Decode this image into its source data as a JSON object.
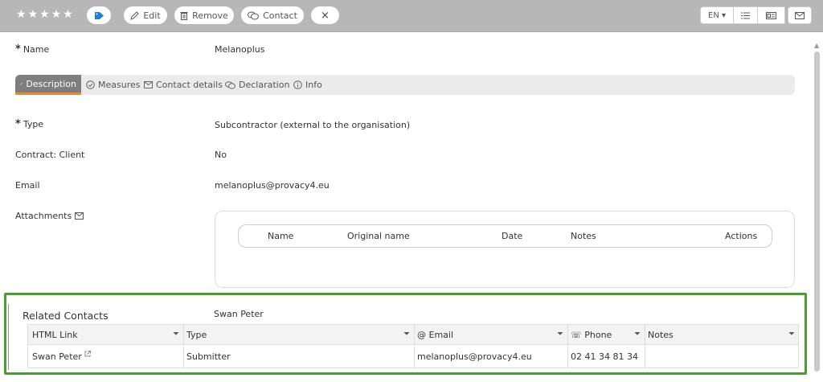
{
  "toolbar": {
    "rating": 5,
    "edit_label": "Edit",
    "remove_label": "Remove",
    "contact_label": "Contact",
    "close_label": "×",
    "language_label": "EN ▾"
  },
  "fields": {
    "name_label": "Name",
    "name_value": "Melanoplus",
    "type_label": "Type",
    "type_value": "Subcontractor (external to the organisation)",
    "contract_label": "Contract: Client",
    "contract_value": "No",
    "email_label": "Email",
    "email_value": "melanoplus@provacy4.eu",
    "attachments_label": "Attachments"
  },
  "tabs": [
    {
      "label": "Description"
    },
    {
      "label": "Measures"
    },
    {
      "label": "Contact details"
    },
    {
      "label": "Declaration"
    },
    {
      "label": "Info"
    }
  ],
  "attachments_table": {
    "columns": [
      "Name",
      "Original name",
      "Date",
      "Notes",
      "Actions"
    ]
  },
  "related_contacts": {
    "title": "Related Contacts",
    "summary": "Swan Peter",
    "columns": [
      "HTML Link",
      "Type",
      "@ Email",
      "☏ Phone",
      "Notes"
    ],
    "rows": [
      {
        "link": "Swan Peter",
        "type": "Submitter",
        "email": "melanoplus@provacy4.eu",
        "phone": "02 41 34 81 34",
        "notes": ""
      }
    ]
  },
  "colors": {
    "accent": "#1e7fd9",
    "tab_underline": "#e58a2f",
    "highlight_border": "#4a9d2f"
  }
}
